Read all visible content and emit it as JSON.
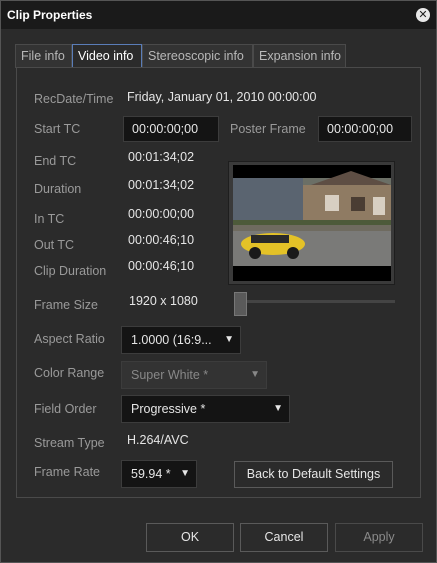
{
  "window": {
    "title": "Clip Properties",
    "close_icon": "close-icon"
  },
  "tabs": [
    {
      "label": "File info",
      "active": false
    },
    {
      "label": "Video info",
      "active": true
    },
    {
      "label": "Stereoscopic info",
      "active": false
    },
    {
      "label": "Expansion info",
      "active": false
    }
  ],
  "fields": {
    "rec_datetime": {
      "label": "RecDate/Time",
      "value": "Friday, January 01, 2010 00:00:00"
    },
    "start_tc": {
      "label": "Start TC",
      "value": "00:00:00;00"
    },
    "poster_frame": {
      "label": "Poster Frame",
      "value": "00:00:00;00"
    },
    "end_tc": {
      "label": "End TC",
      "value": "00:01:34;02"
    },
    "duration": {
      "label": "Duration",
      "value": "00:01:34;02"
    },
    "in_tc": {
      "label": "In TC",
      "value": "00:00:00;00"
    },
    "out_tc": {
      "label": "Out TC",
      "value": "00:00:46;10"
    },
    "clip_duration": {
      "label": "Clip Duration",
      "value": "00:00:46;10"
    },
    "frame_size": {
      "label": "Frame Size",
      "value": "1920 x 1080"
    },
    "aspect_ratio": {
      "label": "Aspect Ratio",
      "value": "1.0000 (16:9..."
    },
    "color_range": {
      "label": "Color Range",
      "value": "Super White *"
    },
    "field_order": {
      "label": "Field Order",
      "value": "Progressive *"
    },
    "stream_type": {
      "label": "Stream Type",
      "value": "H.264/AVC"
    },
    "frame_rate": {
      "label": "Frame Rate",
      "value": "59.94 *"
    }
  },
  "preview": {
    "description_icon": "thumbnail-image",
    "slider_position": 0.0
  },
  "buttons": {
    "back_default": "Back to Default Settings",
    "ok": "OK",
    "cancel": "Cancel",
    "apply": "Apply"
  },
  "colors": {
    "accent": "#5a7db8",
    "background": "#2b2b2b"
  }
}
